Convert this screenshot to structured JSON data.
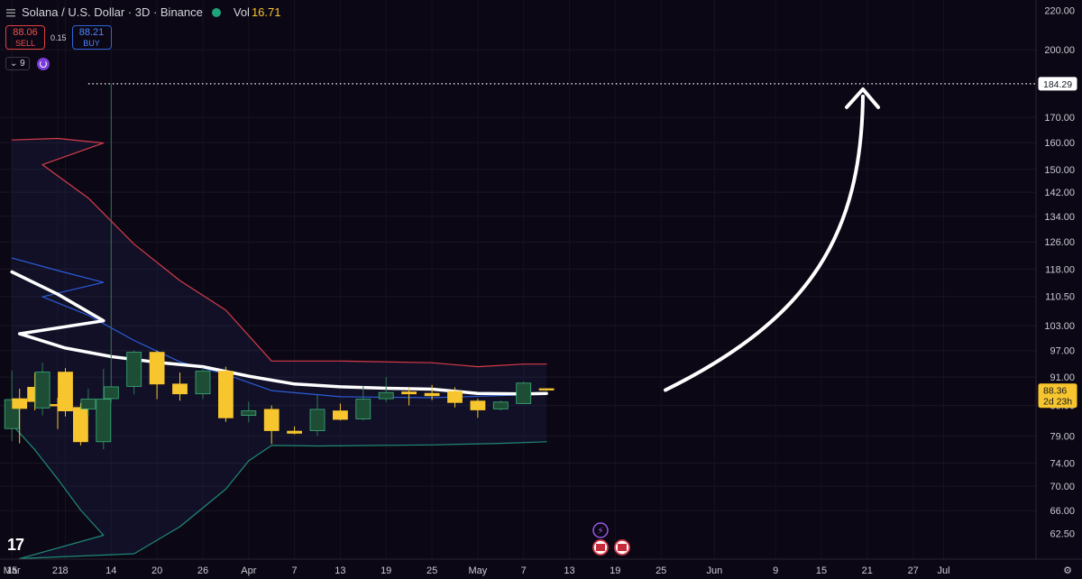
{
  "header": {
    "symbol_title": "Solana / U.S. Dollar · 3D · Binance",
    "vol_label": "Vol",
    "vol_value": "16.71",
    "menu_icon": "hamburger-icon",
    "status_dot_color": "#1fa37a"
  },
  "trade": {
    "sell_price": "88.06",
    "sell_label": "SELL",
    "spread": "0.15",
    "buy_price": "88.21",
    "buy_label": "BUY"
  },
  "indicators": {
    "toggle_label": "9",
    "toggle_icon": "chevron-down-icon"
  },
  "price_badge": {
    "price": "88.36",
    "countdown": "2d 23h"
  },
  "target_label": "184.29",
  "logo_text": "17",
  "colors": {
    "background": "#0c0714",
    "up_candle": "#1e4d36",
    "down_candle": "#f7c52d",
    "upper_band": "#d63c4a",
    "lower_band": "#1f8a78",
    "basis": "#2c5cd9",
    "ma": "#ffffff",
    "target_line": "#ffffff"
  },
  "chart_data": {
    "type": "candlestick",
    "title": "Solana / U.S. Dollar · 3D · Binance",
    "y_axis": {
      "scale": "log",
      "ylim": [
        60.8,
        224
      ],
      "ticks": [
        "220.00",
        "200.00",
        "184.29",
        "170.00",
        "160.00",
        "150.00",
        "142.00",
        "134.00",
        "126.00",
        "118.00",
        "110.50",
        "103.00",
        "97.00",
        "91.00",
        "85.00",
        "79.00",
        "74.00",
        "70.00",
        "66.00",
        "62.50"
      ]
    },
    "x_axis": {
      "ticks": [
        "15",
        "21",
        "Mar",
        "8",
        "14",
        "20",
        "26",
        "Apr",
        "7",
        "13",
        "19",
        "25",
        "May",
        "7",
        "13",
        "19",
        "25",
        "Jun",
        "9",
        "15",
        "21",
        "27",
        "Jul"
      ]
    },
    "target_price": 184.29,
    "target_start_date": "Mar 11",
    "last_price": 88.36,
    "candles": [
      {
        "date": "Feb 15",
        "open": 80.4,
        "high": 92.5,
        "low": 78.0,
        "close": 86.2
      },
      {
        "date": "Feb 18",
        "open": 88.8,
        "high": 92.0,
        "low": 84.0,
        "close": 85.8
      },
      {
        "date": "Feb 21",
        "open": 85.2,
        "high": 86.6,
        "low": 80.3,
        "close": 84.9
      },
      {
        "date": "Feb 24",
        "open": 84.6,
        "high": 85.5,
        "low": 77.2,
        "close": 77.9
      },
      {
        "date": "Feb 27",
        "open": 77.9,
        "high": 92.8,
        "low": 76.5,
        "close": 86.3
      },
      {
        "date": "Mar 2",
        "open": 86.4,
        "high": 88.5,
        "low": 77.6,
        "close": 84.4
      },
      {
        "date": "Mar 5",
        "open": 84.5,
        "high": 94.2,
        "low": 83.0,
        "close": 92.1
      },
      {
        "date": "Mar 8",
        "open": 92.1,
        "high": 93.0,
        "low": 82.8,
        "close": 83.9
      },
      {
        "date": "Mar 11",
        "open": 84.3,
        "high": 88.5,
        "low": 82.8,
        "close": 86.3
      },
      {
        "date": "Mar 14",
        "open": 86.4,
        "high": 184.29,
        "low": 85.5,
        "close": 88.9
      },
      {
        "date": "Mar 17",
        "open": 89.0,
        "high": 97.0,
        "low": 87.3,
        "close": 96.6
      },
      {
        "date": "Mar 20",
        "open": 96.6,
        "high": 97.0,
        "low": 86.3,
        "close": 89.5
      },
      {
        "date": "Mar 23",
        "open": 89.5,
        "high": 92.0,
        "low": 86.0,
        "close": 87.4
      },
      {
        "date": "Mar 26",
        "open": 87.4,
        "high": 93.1,
        "low": 86.3,
        "close": 92.3
      },
      {
        "date": "Mar 29",
        "open": 92.3,
        "high": 93.3,
        "low": 81.7,
        "close": 82.5
      },
      {
        "date": "Apr 1",
        "open": 83.0,
        "high": 85.8,
        "low": 81.6,
        "close": 83.9
      },
      {
        "date": "Apr 4",
        "open": 84.2,
        "high": 85.0,
        "low": 77.5,
        "close": 80.0
      },
      {
        "date": "Apr 7",
        "open": 79.9,
        "high": 80.8,
        "low": 79.3,
        "close": 79.5
      },
      {
        "date": "Apr 10",
        "open": 80.0,
        "high": 87.1,
        "low": 79.0,
        "close": 84.2
      },
      {
        "date": "Apr 13",
        "open": 83.9,
        "high": 85.4,
        "low": 82.0,
        "close": 82.2
      },
      {
        "date": "Apr 16",
        "open": 82.3,
        "high": 89.2,
        "low": 82.0,
        "close": 86.3
      },
      {
        "date": "Apr 19",
        "open": 86.4,
        "high": 91.0,
        "low": 85.7,
        "close": 87.7
      },
      {
        "date": "Apr 22",
        "open": 87.8,
        "high": 88.8,
        "low": 85.0,
        "close": 87.4
      },
      {
        "date": "Apr 25",
        "open": 87.5,
        "high": 89.3,
        "low": 86.1,
        "close": 87.0
      },
      {
        "date": "Apr 28",
        "open": 87.9,
        "high": 88.8,
        "low": 84.6,
        "close": 85.6
      },
      {
        "date": "May 1",
        "open": 85.9,
        "high": 86.4,
        "low": 82.5,
        "close": 84.1
      },
      {
        "date": "May 4",
        "open": 84.3,
        "high": 86.0,
        "low": 84.0,
        "close": 85.7
      },
      {
        "date": "May 7",
        "open": 85.4,
        "high": 90.0,
        "low": 85.3,
        "close": 89.7
      },
      {
        "date": "May 10",
        "open": 88.5,
        "high": 88.6,
        "low": 88.1,
        "close": 88.36
      }
    ],
    "bands": {
      "upper_band": [
        {
          "date": "Feb 15",
          "value": 161.0
        },
        {
          "date": "Feb 21",
          "value": 161.6
        },
        {
          "date": "Feb 27",
          "value": 159.8
        },
        {
          "date": "Mar 5",
          "value": 151.7
        },
        {
          "date": "Mar 11",
          "value": 140.0
        },
        {
          "date": "Mar 17",
          "value": 125.3
        },
        {
          "date": "Mar 23",
          "value": 114.8
        },
        {
          "date": "Mar 29",
          "value": 106.9
        },
        {
          "date": "Apr 4",
          "value": 94.6
        },
        {
          "date": "Apr 13",
          "value": 94.6
        },
        {
          "date": "Apr 25",
          "value": 94.2
        },
        {
          "date": "May 1",
          "value": 93.3
        },
        {
          "date": "May 7",
          "value": 93.9
        },
        {
          "date": "May 10",
          "value": 93.9
        }
      ],
      "basis": [
        {
          "date": "Feb 15",
          "value": 121.2
        },
        {
          "date": "Feb 21",
          "value": 117.6
        },
        {
          "date": "Feb 27",
          "value": 114.3
        },
        {
          "date": "Mar 5",
          "value": 110.4
        },
        {
          "date": "Mar 11",
          "value": 105.6
        },
        {
          "date": "Mar 17",
          "value": 99.4
        },
        {
          "date": "Mar 23",
          "value": 94.4
        },
        {
          "date": "Mar 29",
          "value": 91.6
        },
        {
          "date": "Apr 4",
          "value": 88.1
        },
        {
          "date": "Apr 13",
          "value": 86.8
        },
        {
          "date": "Apr 25",
          "value": 86.6
        },
        {
          "date": "May 7",
          "value": 87.2
        },
        {
          "date": "May 10",
          "value": 87.4
        }
      ],
      "lower_band": [
        {
          "date": "Feb 15",
          "value": 81.2
        },
        {
          "date": "Feb 18",
          "value": 76.4
        },
        {
          "date": "Feb 21",
          "value": 71.2
        },
        {
          "date": "Feb 24",
          "value": 66.1
        },
        {
          "date": "Feb 27",
          "value": 62.2
        },
        {
          "date": "Mar 2",
          "value": 58.8
        },
        {
          "date": "Mar 17",
          "value": 59.5
        },
        {
          "date": "Mar 23",
          "value": 63.5
        },
        {
          "date": "Mar 29",
          "value": 69.5
        },
        {
          "date": "Apr 1",
          "value": 74.4
        },
        {
          "date": "Apr 4",
          "value": 77.2
        },
        {
          "date": "Apr 10",
          "value": 77.1
        },
        {
          "date": "Apr 25",
          "value": 77.3
        },
        {
          "date": "May 4",
          "value": 77.6
        },
        {
          "date": "May 10",
          "value": 77.9
        }
      ]
    },
    "moving_average": [
      {
        "date": "Feb 15",
        "value": 117.2
      },
      {
        "date": "Feb 21",
        "value": 111.1
      },
      {
        "date": "Feb 27",
        "value": 104.2
      },
      {
        "date": "Mar 2",
        "value": 101.0
      },
      {
        "date": "Mar 8",
        "value": 97.6
      },
      {
        "date": "Mar 14",
        "value": 95.6
      },
      {
        "date": "Mar 20",
        "value": 94.3
      },
      {
        "date": "Mar 26",
        "value": 93.3
      },
      {
        "date": "Apr 1",
        "value": 91.2
      },
      {
        "date": "Apr 7",
        "value": 89.5
      },
      {
        "date": "Apr 13",
        "value": 88.9
      },
      {
        "date": "Apr 19",
        "value": 88.6
      },
      {
        "date": "Apr 25",
        "value": 88.4
      },
      {
        "date": "May 1",
        "value": 87.5
      },
      {
        "date": "May 7",
        "value": 87.4
      },
      {
        "date": "May 10",
        "value": 87.5
      }
    ]
  }
}
